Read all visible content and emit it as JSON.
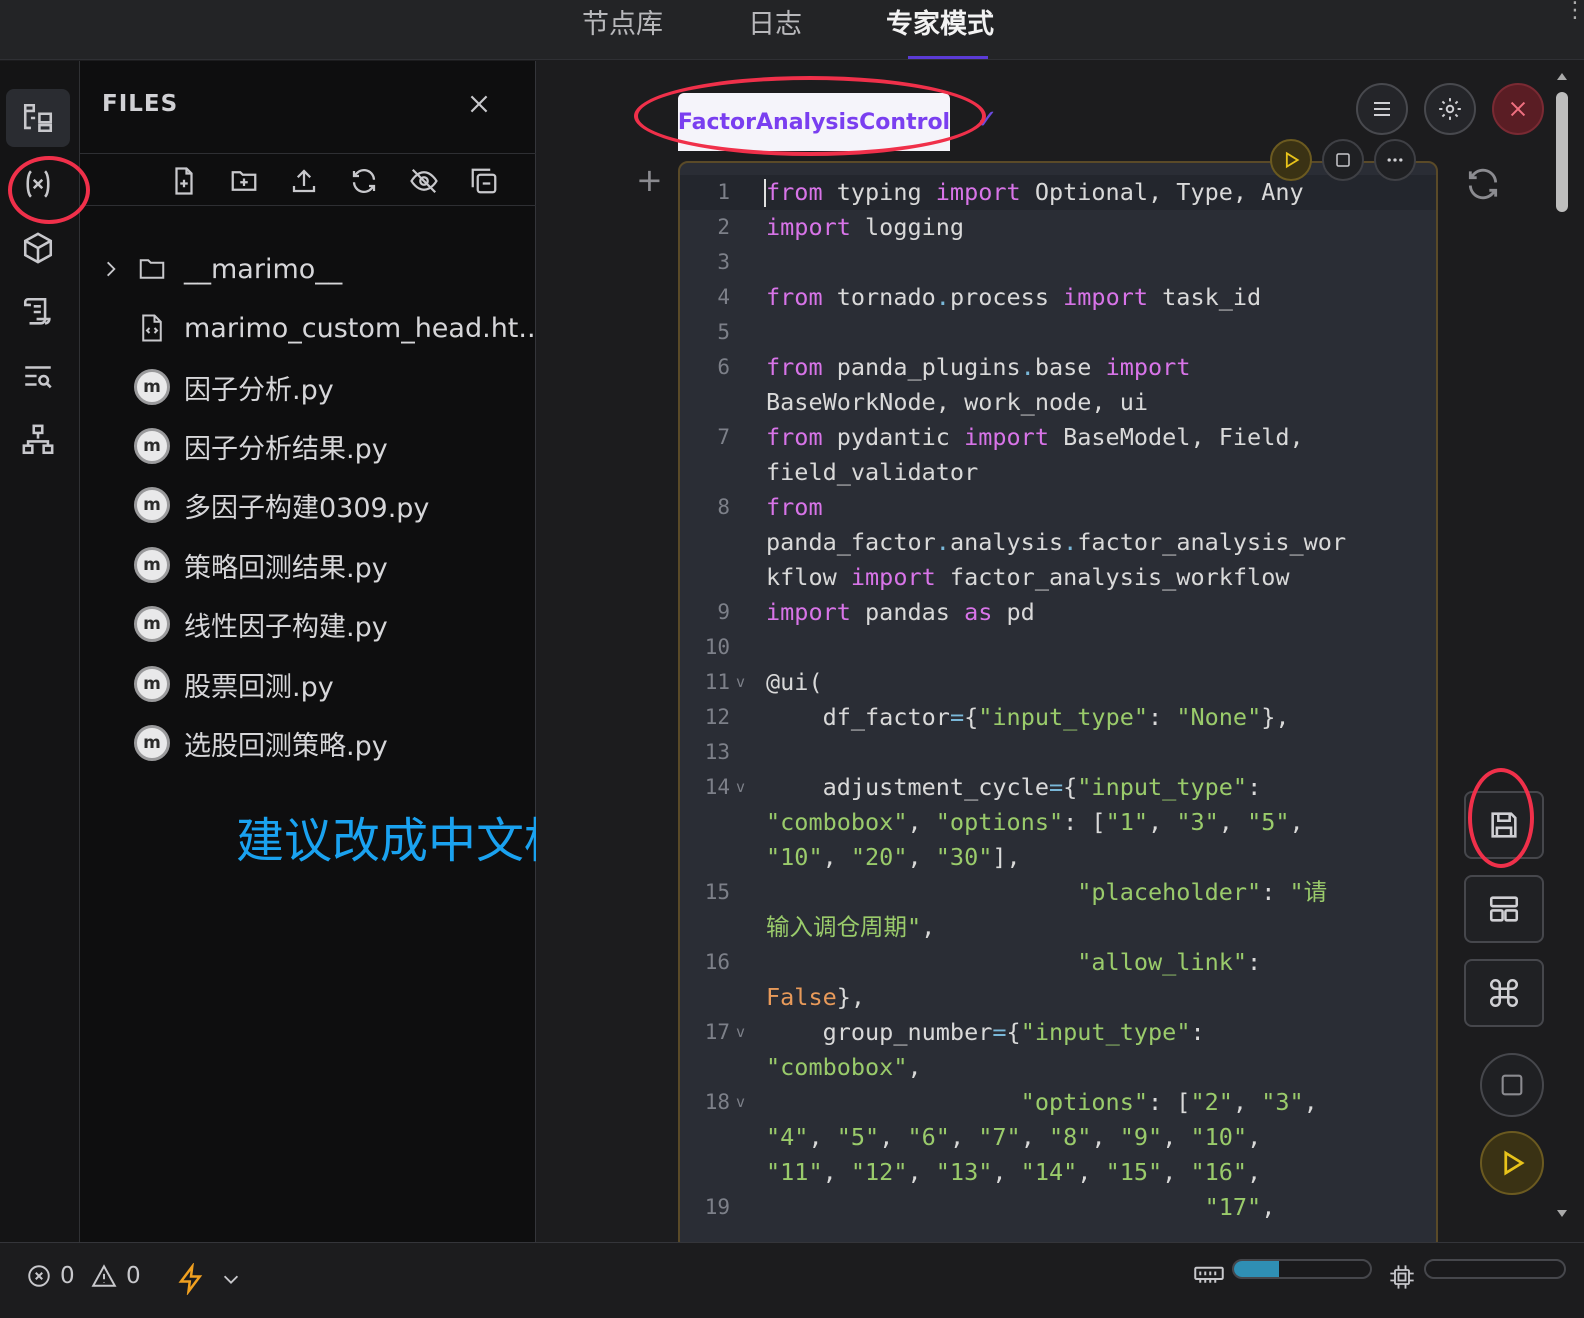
{
  "top_tabs": [
    {
      "label": "节点库"
    },
    {
      "label": "日志"
    },
    {
      "label": "专家模式"
    }
  ],
  "files_panel": {
    "title": "FILES",
    "items": [
      {
        "label": "__marimo__",
        "kind": "folder"
      },
      {
        "label": "marimo_custom_head.ht...",
        "kind": "html"
      },
      {
        "label": "因子分析.py",
        "kind": "marimo"
      },
      {
        "label": "因子分析结果.py",
        "kind": "marimo"
      },
      {
        "label": "多因子构建0309.py",
        "kind": "marimo"
      },
      {
        "label": "策略回测结果.py",
        "kind": "marimo"
      },
      {
        "label": "线性因子构建.py",
        "kind": "marimo"
      },
      {
        "label": "股票回测.py",
        "kind": "marimo"
      },
      {
        "label": "选股回测策略.py",
        "kind": "marimo"
      }
    ],
    "marimo_badge": "m"
  },
  "annotation_text": "建议改成中文标注",
  "editor": {
    "cell_tab": "FactorAnalysisControl",
    "tab_check": "✓",
    "add_cell": "+"
  },
  "status_bar": {
    "errors": "0",
    "warnings": "0",
    "memory_fraction": 0.33,
    "cpu_fraction": 0.0
  },
  "colors": {
    "accent": "#5b3bd6",
    "keyword": "#d874e8",
    "string": "#9acb6b",
    "annotation_circle": "#f0304a",
    "suggestion_text": "#1aa2f0",
    "run_button": "#e8c31a"
  }
}
